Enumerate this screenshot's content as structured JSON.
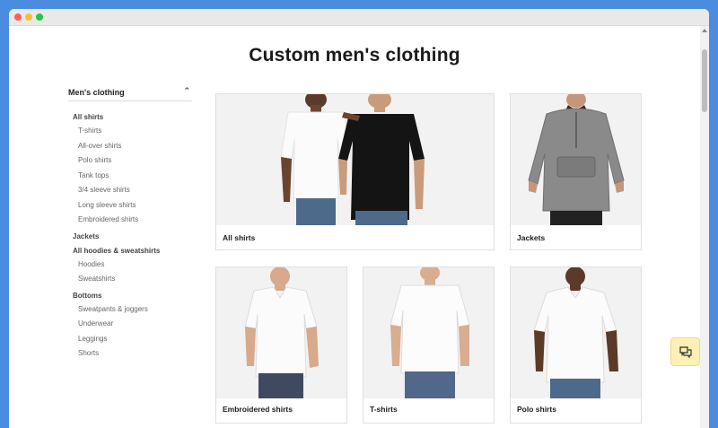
{
  "page": {
    "title": "Custom men's clothing"
  },
  "sidebar": {
    "heading": "Men's clothing",
    "collapse_icon": "chevron-up-icon",
    "items": [
      {
        "label": "All shirts",
        "group": true
      },
      {
        "label": "T-shirts",
        "group": false
      },
      {
        "label": "All-over shirts",
        "group": false
      },
      {
        "label": "Polo shirts",
        "group": false
      },
      {
        "label": "Tank tops",
        "group": false
      },
      {
        "label": "3/4 sleeve shirts",
        "group": false
      },
      {
        "label": "Long sleeve shirts",
        "group": false
      },
      {
        "label": "Embroidered shirts",
        "group": false
      },
      {
        "label": "Jackets",
        "group": true
      },
      {
        "label": "All hoodies & sweatshirts",
        "group": true
      },
      {
        "label": "Hoodies",
        "group": false
      },
      {
        "label": "Sweatshirts",
        "group": false
      },
      {
        "label": "Bottoms",
        "group": true
      },
      {
        "label": "Sweatpants & joggers",
        "group": false
      },
      {
        "label": "Underwear",
        "group": false
      },
      {
        "label": "Leggings",
        "group": false
      },
      {
        "label": "Shorts",
        "group": false
      }
    ]
  },
  "cards": [
    {
      "label": "All shirts"
    },
    {
      "label": "Jackets"
    },
    {
      "label": "Embroidered shirts"
    },
    {
      "label": "T-shirts"
    },
    {
      "label": "Polo shirts"
    }
  ],
  "chat": {
    "icon": "chat-bubbles-icon"
  },
  "colors": {
    "frame_background": "#4a8de0",
    "chat_button": "#fdf0b4"
  }
}
